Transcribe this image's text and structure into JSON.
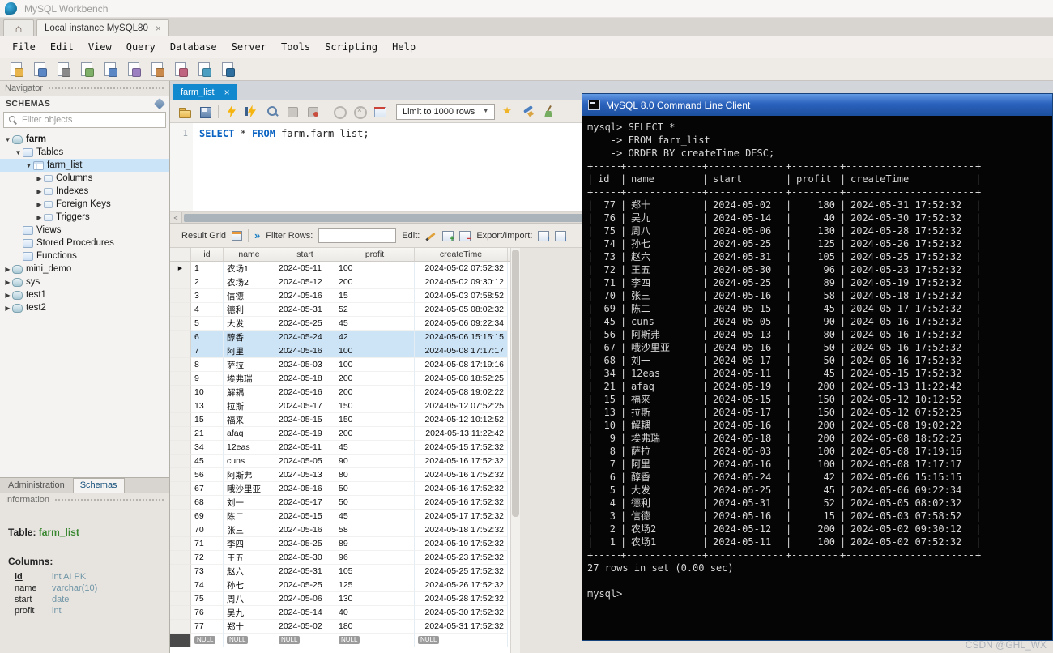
{
  "window": {
    "title": "MySQL Workbench",
    "connection_tab": "Local instance MySQL80"
  },
  "menus": [
    "File",
    "Edit",
    "View",
    "Query",
    "Database",
    "Server",
    "Tools",
    "Scripting",
    "Help"
  ],
  "navigator": {
    "title": "Navigator",
    "schemas_header": "SCHEMAS",
    "filter_placeholder": "Filter objects",
    "tree": [
      {
        "label": "farm",
        "level": 0,
        "arrow": "down",
        "icon": "schema",
        "bold": true
      },
      {
        "label": "Tables",
        "level": 1,
        "arrow": "down",
        "icon": "folder"
      },
      {
        "label": "farm_list",
        "level": 2,
        "arrow": "down",
        "icon": "table",
        "selected": true
      },
      {
        "label": "Columns",
        "level": 3,
        "arrow": "right",
        "icon": "sub"
      },
      {
        "label": "Indexes",
        "level": 3,
        "arrow": "right",
        "icon": "sub"
      },
      {
        "label": "Foreign Keys",
        "level": 3,
        "arrow": "right",
        "icon": "sub"
      },
      {
        "label": "Triggers",
        "level": 3,
        "arrow": "right",
        "icon": "sub"
      },
      {
        "label": "Views",
        "level": 1,
        "arrow": "none",
        "icon": "folder"
      },
      {
        "label": "Stored Procedures",
        "level": 1,
        "arrow": "none",
        "icon": "folder"
      },
      {
        "label": "Functions",
        "level": 1,
        "arrow": "none",
        "icon": "folder"
      },
      {
        "label": "mini_demo",
        "level": 0,
        "arrow": "right",
        "icon": "schema"
      },
      {
        "label": "sys",
        "level": 0,
        "arrow": "right",
        "icon": "schema"
      },
      {
        "label": "test1",
        "level": 0,
        "arrow": "right",
        "icon": "schema"
      },
      {
        "label": "test2",
        "level": 0,
        "arrow": "right",
        "icon": "schema"
      }
    ],
    "bottom_tabs": [
      "Administration",
      "Schemas"
    ],
    "information_label": "Information",
    "info": {
      "table_label": "Table:",
      "table_name": "farm_list",
      "columns_label": "Columns:",
      "columns": [
        {
          "name": "id",
          "type": "int AI PK",
          "pk": true
        },
        {
          "name": "name",
          "type": "varchar(10)"
        },
        {
          "name": "start",
          "type": "date"
        },
        {
          "name": "profit",
          "type": "int"
        }
      ]
    }
  },
  "editor": {
    "tab_label": "farm_list",
    "limit_dropdown": "Limit to 1000 rows",
    "line_number": "1",
    "sql_tokens": [
      {
        "text": "SELECT",
        "kw": true
      },
      {
        "text": " * ",
        "kw": false
      },
      {
        "text": "FROM",
        "kw": true
      },
      {
        "text": " farm.farm_list;",
        "kw": false
      }
    ]
  },
  "result": {
    "toolbar": {
      "grid_label": "Result Grid",
      "filter_label": "Filter Rows:",
      "edit_label": "Edit:",
      "export_label": "Export/Import:"
    },
    "columns": [
      "id",
      "name",
      "start",
      "profit",
      "createTime"
    ],
    "rows": [
      [
        1,
        "农场1",
        "2024-05-11",
        100,
        "2024-05-02 07:52:32"
      ],
      [
        2,
        "农场2",
        "2024-05-12",
        200,
        "2024-05-02 09:30:12"
      ],
      [
        3,
        "信德",
        "2024-05-16",
        15,
        "2024-05-03 07:58:52"
      ],
      [
        4,
        "德利",
        "2024-05-31",
        52,
        "2024-05-05 08:02:32"
      ],
      [
        5,
        "大发",
        "2024-05-25",
        45,
        "2024-05-06 09:22:34"
      ],
      [
        6,
        "醇香",
        "2024-05-24",
        42,
        "2024-05-06 15:15:15"
      ],
      [
        7,
        "阿里",
        "2024-05-16",
        100,
        "2024-05-08 17:17:17"
      ],
      [
        8,
        "萨拉",
        "2024-05-03",
        100,
        "2024-05-08 17:19:16"
      ],
      [
        9,
        "埃弗瑞",
        "2024-05-18",
        200,
        "2024-05-08 18:52:25"
      ],
      [
        10,
        "解耦",
        "2024-05-16",
        200,
        "2024-05-08 19:02:22"
      ],
      [
        13,
        "拉斯",
        "2024-05-17",
        150,
        "2024-05-12 07:52:25"
      ],
      [
        15,
        "福来",
        "2024-05-15",
        150,
        "2024-05-12 10:12:52"
      ],
      [
        21,
        "afaq",
        "2024-05-19",
        200,
        "2024-05-13 11:22:42"
      ],
      [
        34,
        "12eas",
        "2024-05-11",
        45,
        "2024-05-15 17:52:32"
      ],
      [
        45,
        "cuns",
        "2024-05-05",
        90,
        "2024-05-16 17:52:32"
      ],
      [
        56,
        "阿斯弗",
        "2024-05-13",
        80,
        "2024-05-16 17:52:32"
      ],
      [
        67,
        "哦沙里亚",
        "2024-05-16",
        50,
        "2024-05-16 17:52:32"
      ],
      [
        68,
        "刘一",
        "2024-05-17",
        50,
        "2024-05-16 17:52:32"
      ],
      [
        69,
        "陈二",
        "2024-05-15",
        45,
        "2024-05-17 17:52:32"
      ],
      [
        70,
        "张三",
        "2024-05-16",
        58,
        "2024-05-18 17:52:32"
      ],
      [
        71,
        "李四",
        "2024-05-25",
        89,
        "2024-05-19 17:52:32"
      ],
      [
        72,
        "王五",
        "2024-05-30",
        96,
        "2024-05-23 17:52:32"
      ],
      [
        73,
        "赵六",
        "2024-05-31",
        105,
        "2024-05-25 17:52:32"
      ],
      [
        74,
        "孙七",
        "2024-05-25",
        125,
        "2024-05-26 17:52:32"
      ],
      [
        75,
        "周八",
        "2024-05-06",
        130,
        "2024-05-28 17:52:32"
      ],
      [
        76,
        "吴九",
        "2024-05-14",
        40,
        "2024-05-30 17:52:32"
      ],
      [
        77,
        "郑十",
        "2024-05-02",
        180,
        "2024-05-31 17:52:32"
      ]
    ],
    "selected_ids": [
      6,
      7
    ],
    "null_text": "NULL"
  },
  "terminal": {
    "title": "MySQL 8.0 Command Line Client",
    "query_lines": [
      "mysql> SELECT *",
      "    -> FROM farm_list",
      "    -> ORDER BY createTime DESC;"
    ],
    "columns": [
      "id",
      "name",
      "start",
      "profit",
      "createTime"
    ],
    "rows": [
      [
        77,
        "郑十",
        "2024-05-02",
        180,
        "2024-05-31 17:52:32"
      ],
      [
        76,
        "吴九",
        "2024-05-14",
        40,
        "2024-05-30 17:52:32"
      ],
      [
        75,
        "周八",
        "2024-05-06",
        130,
        "2024-05-28 17:52:32"
      ],
      [
        74,
        "孙七",
        "2024-05-25",
        125,
        "2024-05-26 17:52:32"
      ],
      [
        73,
        "赵六",
        "2024-05-31",
        105,
        "2024-05-25 17:52:32"
      ],
      [
        72,
        "王五",
        "2024-05-30",
        96,
        "2024-05-23 17:52:32"
      ],
      [
        71,
        "李四",
        "2024-05-25",
        89,
        "2024-05-19 17:52:32"
      ],
      [
        70,
        "张三",
        "2024-05-16",
        58,
        "2024-05-18 17:52:32"
      ],
      [
        69,
        "陈二",
        "2024-05-15",
        45,
        "2024-05-17 17:52:32"
      ],
      [
        45,
        "cuns",
        "2024-05-05",
        90,
        "2024-05-16 17:52:32"
      ],
      [
        56,
        "阿斯弗",
        "2024-05-13",
        80,
        "2024-05-16 17:52:32"
      ],
      [
        67,
        "哦沙里亚",
        "2024-05-16",
        50,
        "2024-05-16 17:52:32"
      ],
      [
        68,
        "刘一",
        "2024-05-17",
        50,
        "2024-05-16 17:52:32"
      ],
      [
        34,
        "12eas",
        "2024-05-11",
        45,
        "2024-05-15 17:52:32"
      ],
      [
        21,
        "afaq",
        "2024-05-19",
        200,
        "2024-05-13 11:22:42"
      ],
      [
        15,
        "福来",
        "2024-05-15",
        150,
        "2024-05-12 10:12:52"
      ],
      [
        13,
        "拉斯",
        "2024-05-17",
        150,
        "2024-05-12 07:52:25"
      ],
      [
        10,
        "解耦",
        "2024-05-16",
        200,
        "2024-05-08 19:02:22"
      ],
      [
        9,
        "埃弗瑞",
        "2024-05-18",
        200,
        "2024-05-08 18:52:25"
      ],
      [
        8,
        "萨拉",
        "2024-05-03",
        100,
        "2024-05-08 17:19:16"
      ],
      [
        7,
        "阿里",
        "2024-05-16",
        100,
        "2024-05-08 17:17:17"
      ],
      [
        6,
        "醇香",
        "2024-05-24",
        42,
        "2024-05-06 15:15:15"
      ],
      [
        5,
        "大发",
        "2024-05-25",
        45,
        "2024-05-06 09:22:34"
      ],
      [
        4,
        "德利",
        "2024-05-31",
        52,
        "2024-05-05 08:02:32"
      ],
      [
        3,
        "信德",
        "2024-05-16",
        15,
        "2024-05-03 07:58:52"
      ],
      [
        2,
        "农场2",
        "2024-05-12",
        200,
        "2024-05-02 09:30:12"
      ],
      [
        1,
        "农场1",
        "2024-05-11",
        100,
        "2024-05-02 07:52:32"
      ]
    ],
    "status": "27 rows in set (0.00 sec)",
    "prompt": "mysql>"
  },
  "watermark": "CSDN @GHL_WX"
}
